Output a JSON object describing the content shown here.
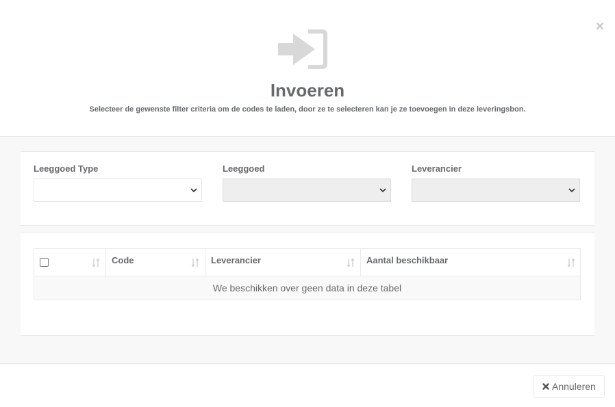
{
  "modal": {
    "close_symbol": "×",
    "icon": "sign-in-icon",
    "title": "Invoeren",
    "subtitle": "Selecteer de gewenste filter criteria om de codes te laden, door ze te selecteren kan je ze toevoegen in deze leveringsbon."
  },
  "filters": [
    {
      "label": "Leeggoed Type",
      "value": "",
      "disabled": false
    },
    {
      "label": "Leeggoed",
      "value": "",
      "disabled": true
    },
    {
      "label": "Leverancier",
      "value": "",
      "disabled": true
    }
  ],
  "table": {
    "columns": [
      "",
      "Code",
      "Leverancier",
      "Aantal beschikbaar"
    ],
    "empty_message": "We beschikken over geen data in deze tabel"
  },
  "footer": {
    "cancel_label": "Annuleren",
    "cancel_icon": "times-icon"
  },
  "colors": {
    "text": "#676a6c",
    "icon_gray": "#d8d8d8",
    "body_bg": "#f8f8f9"
  }
}
